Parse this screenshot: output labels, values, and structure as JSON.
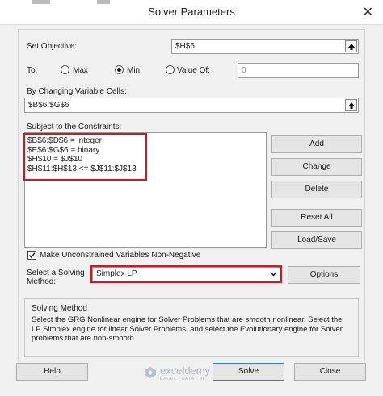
{
  "window": {
    "title": "Solver Parameters",
    "close_glyph": "✕"
  },
  "objective": {
    "label": "Set Objective:",
    "label_u": "t",
    "value": "$H$6"
  },
  "to": {
    "label": "To:",
    "options": [
      {
        "label": "Max",
        "selected": false
      },
      {
        "label": "Min",
        "selected": true
      },
      {
        "label": "Value Of:",
        "selected": false
      }
    ],
    "value_of": "0"
  },
  "changing": {
    "label": "By Changing Variable Cells:",
    "value": "$B$6:$G$6"
  },
  "constraints": {
    "label": "Subject to the Constraints:",
    "items": [
      "$B$6:$D$6 = integer",
      "$E$6:$G$6 = binary",
      "$H$10 = $J$10",
      "$H$11:$H$13 <= $J$11:$J$13"
    ]
  },
  "side_buttons": {
    "add": "Add",
    "change": "Change",
    "delete": "Delete",
    "reset_all": "Reset All",
    "load_save": "Load/Save"
  },
  "non_negative": {
    "label": "Make Unconstrained Variables Non-Negative",
    "checked": true
  },
  "method": {
    "label_line1": "Select a Solving",
    "label_line2": "Method:",
    "value": "Simplex LP",
    "options_button": "Options"
  },
  "solving_method": {
    "title": "Solving Method",
    "description": "Select the GRG Nonlinear engine for Solver Problems that are smooth nonlinear. Select the LP Simplex engine for linear Solver Problems, and select the Evolutionary engine for Solver problems that are non-smooth."
  },
  "footer": {
    "help": "Help",
    "solve": "Solve",
    "close": "Close"
  },
  "watermark": {
    "brand": "exceldemy",
    "tagline": "EXCEL · DATA · BI"
  },
  "colors": {
    "highlight": "#e0101a",
    "background": "#f0f0f0"
  }
}
